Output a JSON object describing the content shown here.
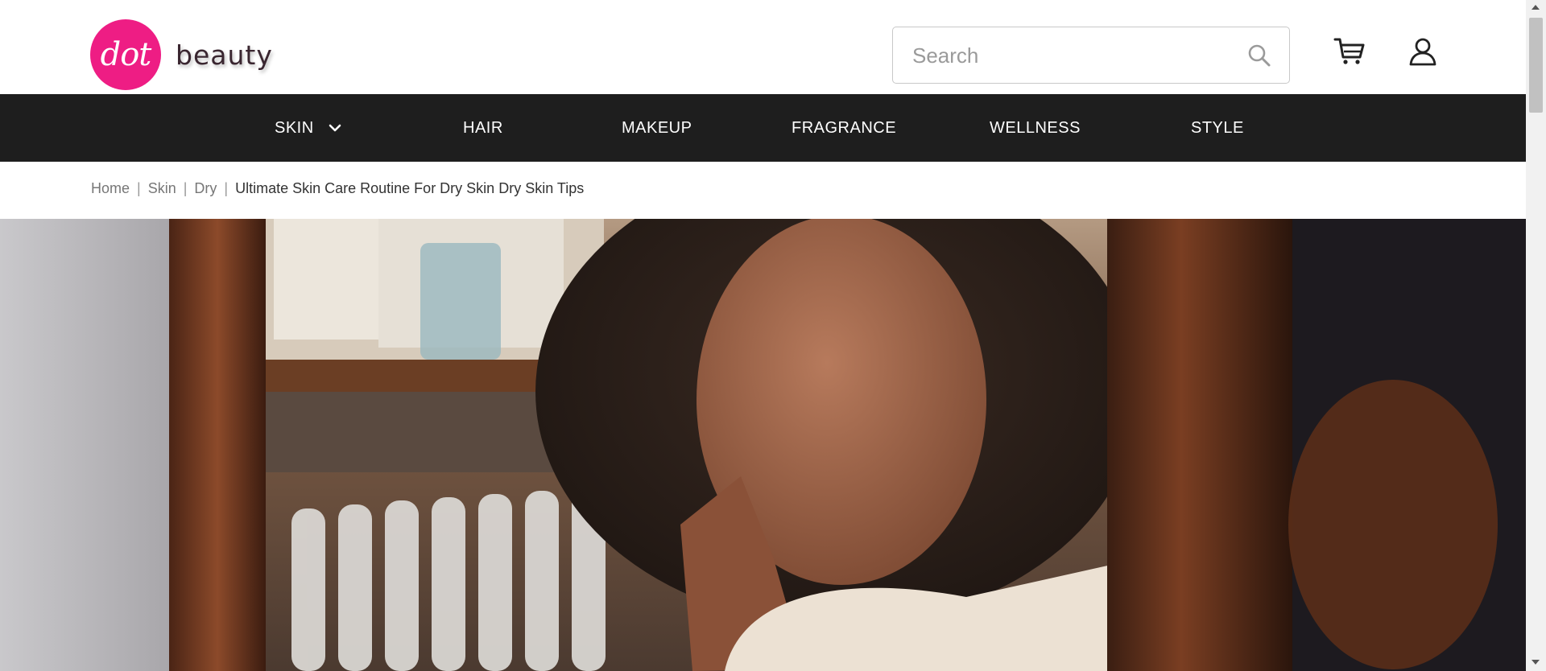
{
  "brand": {
    "logo_mark": "dot",
    "wordmark": "beauty",
    "accent_color": "#ee1d84"
  },
  "header": {
    "search_placeholder": "Search",
    "search_value": "",
    "icons": [
      "search-icon",
      "cart-icon",
      "user-icon"
    ]
  },
  "nav": {
    "background": "#1e1e1e",
    "items": [
      {
        "label": "SKIN",
        "has_dropdown": true
      },
      {
        "label": "HAIR",
        "has_dropdown": false
      },
      {
        "label": "MAKEUP",
        "has_dropdown": false
      },
      {
        "label": "FRAGRANCE",
        "has_dropdown": false
      },
      {
        "label": "WELLNESS",
        "has_dropdown": false
      },
      {
        "label": "STYLE",
        "has_dropdown": false
      }
    ]
  },
  "breadcrumb": {
    "items": [
      "Home",
      "Skin",
      "Dry"
    ],
    "separator": "|",
    "current": "Ultimate Skin Care Routine For Dry Skin Dry Skin Tips"
  }
}
